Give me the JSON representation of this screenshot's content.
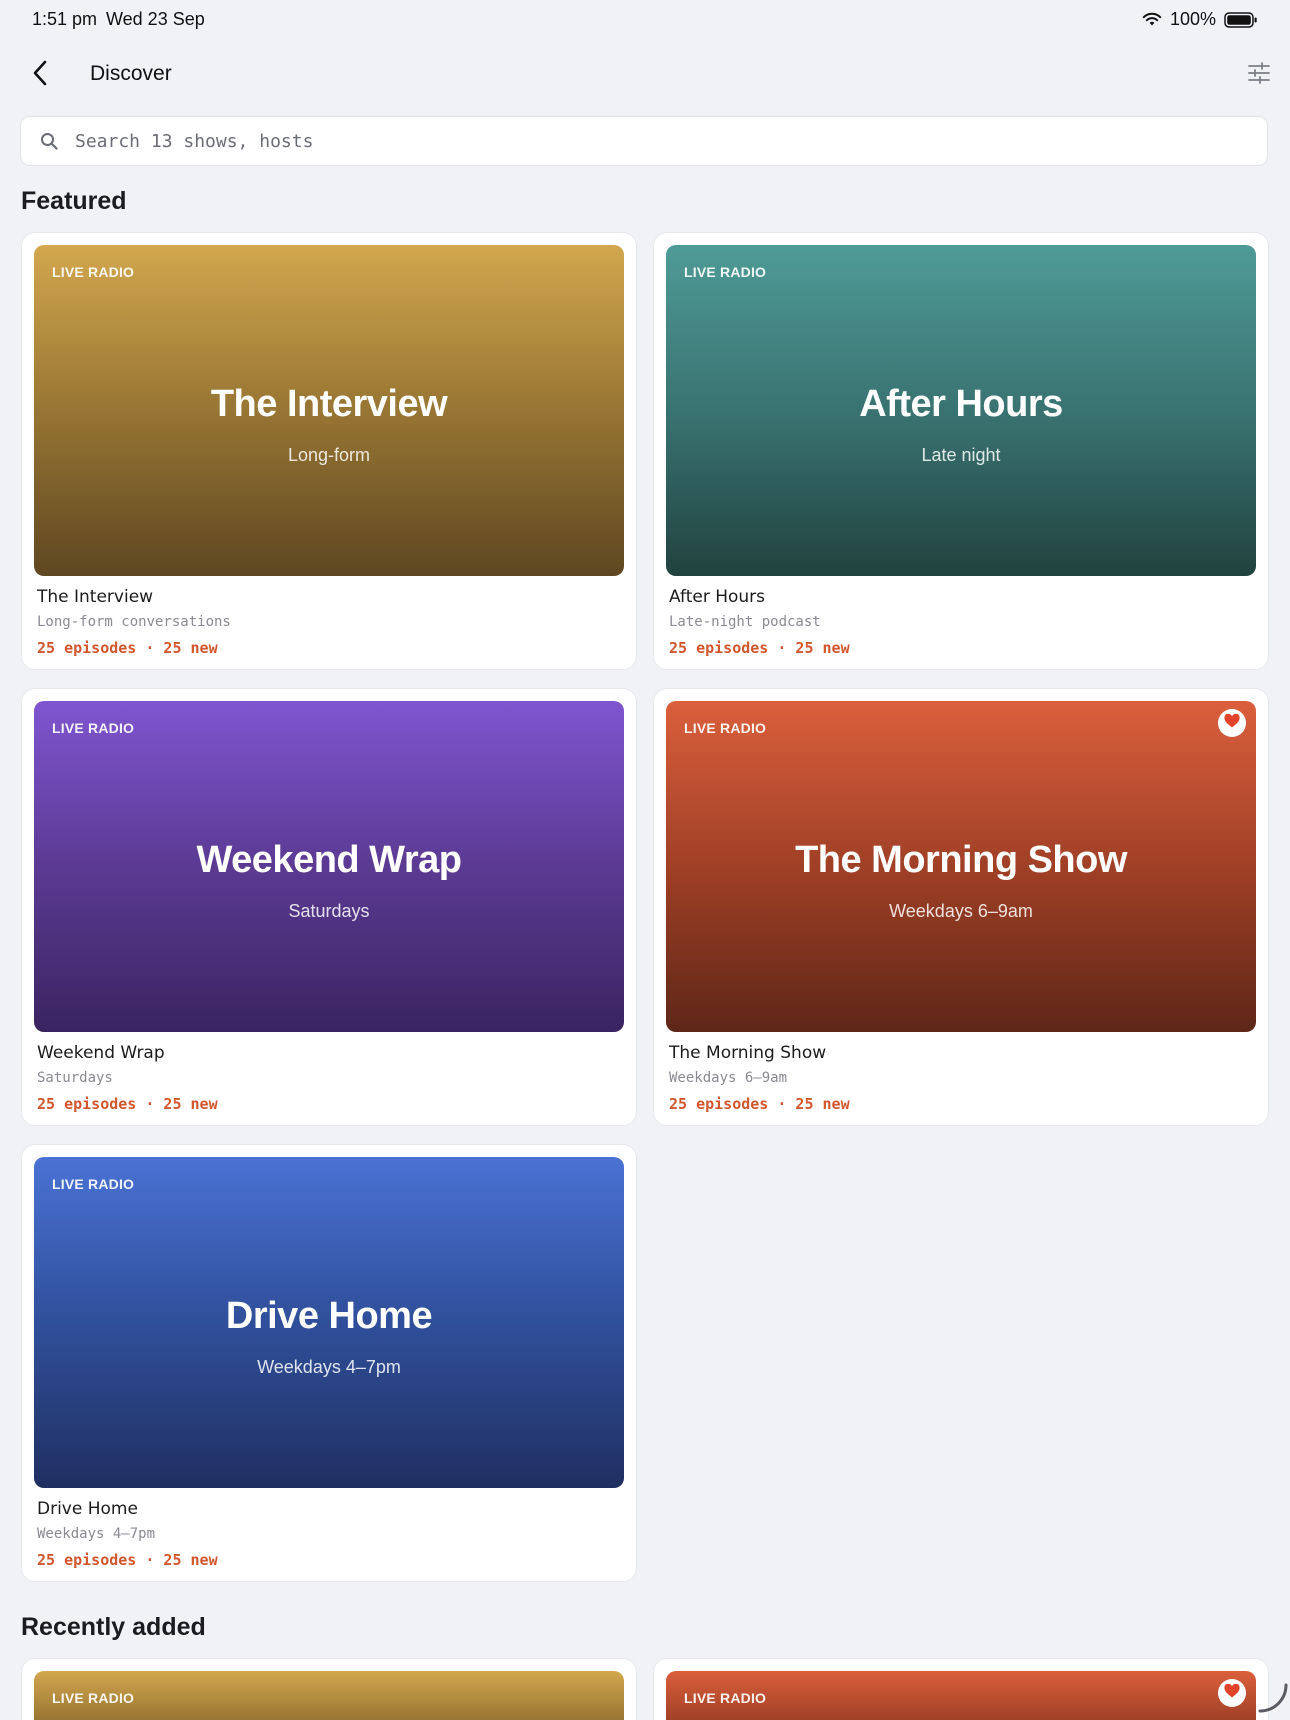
{
  "status_bar": {
    "time": "1:51 pm",
    "date": "Wed 23 Sep",
    "battery": "100%"
  },
  "header": {
    "title": "Discover",
    "back_icon": "chevron-left-icon",
    "filter_icon": "sliders-icon"
  },
  "search": {
    "placeholder": "Search 13 shows, hosts",
    "value": ""
  },
  "sections": {
    "featured": "Featured",
    "recent": "Recently added"
  },
  "featured": [
    {
      "badge": "LIVE RADIO",
      "art_title": "The Interview",
      "art_subtitle": "Long-form",
      "title": "The Interview",
      "description": "Long-form conversations",
      "stats": "25 episodes · 25 new",
      "favorite": false
    },
    {
      "badge": "LIVE RADIO",
      "art_title": "After Hours",
      "art_subtitle": "Late night",
      "title": "After Hours",
      "description": "Late-night podcast",
      "stats": "25 episodes · 25 new",
      "favorite": false
    },
    {
      "badge": "LIVE RADIO",
      "art_title": "Weekend Wrap",
      "art_subtitle": "Saturdays",
      "title": "Weekend Wrap",
      "description": "Saturdays",
      "stats": "25 episodes · 25 new",
      "favorite": false
    },
    {
      "badge": "LIVE RADIO",
      "art_title": "The Morning Show",
      "art_subtitle": "Weekdays 6–9am",
      "title": "The Morning Show",
      "description": "Weekdays 6–9am",
      "stats": "25 episodes · 25 new",
      "favorite": true
    },
    {
      "badge": "LIVE RADIO",
      "art_title": "Drive Home",
      "art_subtitle": "Weekdays 4–7pm",
      "title": "Drive Home",
      "description": "Weekdays 4–7pm",
      "stats": "25 episodes · 25 new",
      "favorite": false
    }
  ],
  "recent": [
    {
      "badge": "LIVE RADIO",
      "favorite": false
    },
    {
      "badge": "LIVE RADIO",
      "favorite": true
    }
  ],
  "colors": {
    "accent": "#d2562e",
    "background": "#f1f2f6",
    "heart": "#e0452b"
  }
}
